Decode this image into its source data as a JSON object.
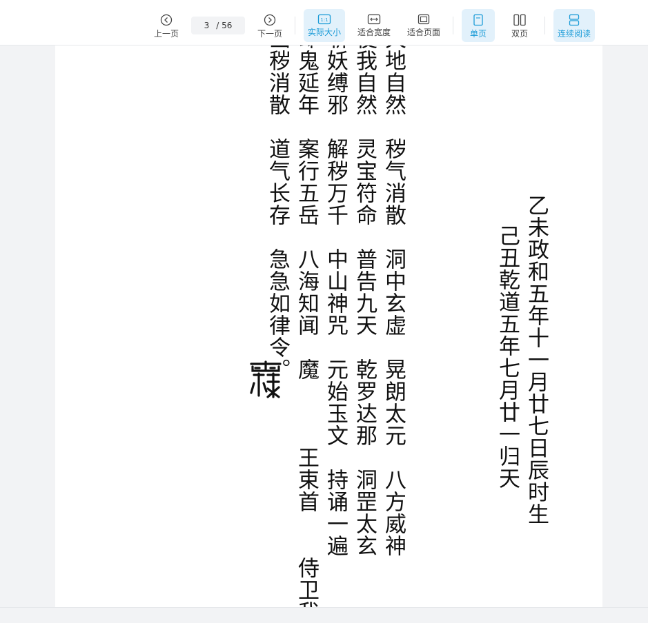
{
  "toolbar": {
    "prev_label": "上一页",
    "next_label": "下一页",
    "current_page": "3",
    "total_pages": "/ 56",
    "actual_size_label": "实际大小",
    "actual_size_glyph": "1:1",
    "fit_width_label": "适合宽度",
    "fit_page_label": "适合页面",
    "single_page_label": "单页",
    "double_page_label": "双页",
    "continuous_label": "连续阅读",
    "accent_color": "#1a9bd7"
  },
  "document": {
    "columns": [
      "乙未政和五年十一月廿七日辰时生",
      "己丑乾道五年七月廿一归天",
      "天地自然　秽气消散　洞中玄虚　晃朗太元　八方威神",
      "使我自然　灵宝符命　普告九天　乾罗达那　洞罡太玄",
      "斩妖缚邪　解秽万千　中山神咒　元始玉文　持诵一遍",
      "却鬼延年　案行五岳　八海知闻　魔　　　王束首　　侍卫我斩",
      "凶秽消散　道气长存　急急如律令。"
    ],
    "seal_glyph": "𩃬"
  }
}
